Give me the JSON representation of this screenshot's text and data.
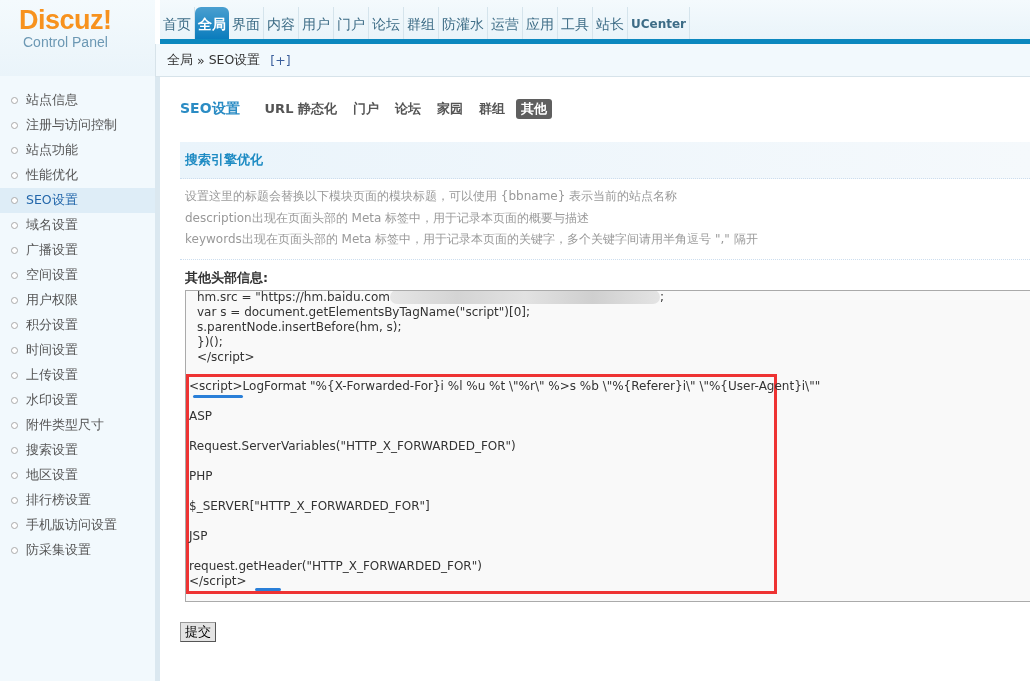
{
  "logo": {
    "brand": "Discuz",
    "mark": "!",
    "subtitle": "Control Panel"
  },
  "nav": [
    {
      "label": "首页",
      "selected": false
    },
    {
      "label": "全局",
      "selected": true
    },
    {
      "label": "界面",
      "selected": false
    },
    {
      "label": "内容",
      "selected": false
    },
    {
      "label": "用户",
      "selected": false
    },
    {
      "label": "门户",
      "selected": false
    },
    {
      "label": "论坛",
      "selected": false
    },
    {
      "label": "群组",
      "selected": false
    },
    {
      "label": "防灌水",
      "selected": false
    },
    {
      "label": "运营",
      "selected": false
    },
    {
      "label": "应用",
      "selected": false
    },
    {
      "label": "工具",
      "selected": false
    },
    {
      "label": "站长",
      "selected": false
    },
    {
      "label": "UCenter",
      "selected": false
    }
  ],
  "breadcrumb": {
    "section": "全局",
    "separator": "»",
    "page": "SEO设置",
    "add": "[+]"
  },
  "sidebar": {
    "items": [
      {
        "label": "站点信息",
        "selected": false
      },
      {
        "label": "注册与访问控制",
        "selected": false
      },
      {
        "label": "站点功能",
        "selected": false
      },
      {
        "label": "性能优化",
        "selected": false
      },
      {
        "label": "SEO设置",
        "selected": true
      },
      {
        "label": "域名设置",
        "selected": false
      },
      {
        "label": "广播设置",
        "selected": false
      },
      {
        "label": "空间设置",
        "selected": false
      },
      {
        "label": "用户权限",
        "selected": false
      },
      {
        "label": "积分设置",
        "selected": false
      },
      {
        "label": "时间设置",
        "selected": false
      },
      {
        "label": "上传设置",
        "selected": false
      },
      {
        "label": "水印设置",
        "selected": false
      },
      {
        "label": "附件类型尺寸",
        "selected": false
      },
      {
        "label": "搜索设置",
        "selected": false
      },
      {
        "label": "地区设置",
        "selected": false
      },
      {
        "label": "排行榜设置",
        "selected": false
      },
      {
        "label": "手机版访问设置",
        "selected": false
      },
      {
        "label": "防采集设置",
        "selected": false
      }
    ]
  },
  "page_title": "SEO设置",
  "tabs": [
    {
      "label": "URL 静态化",
      "selected": false
    },
    {
      "label": "门户",
      "selected": false
    },
    {
      "label": "论坛",
      "selected": false
    },
    {
      "label": "家园",
      "selected": false
    },
    {
      "label": "群组",
      "selected": false
    },
    {
      "label": "其他",
      "selected": true
    }
  ],
  "section_title": "搜索引擎优化",
  "tips": [
    "设置这里的标题会替换以下模块页面的模块标题，可以使用 {bbname} 表示当前的站点名称",
    "description出现在页面头部的 Meta 标签中，用于记录本页面的概要与描述",
    "keywords出现在页面头部的 Meta 标签中，用于记录本页面的关键字，多个关键字间请用半角逗号 \",\" 隔开"
  ],
  "field_label": "其他头部信息:",
  "code": {
    "lines": [
      {
        "text": "hm.src = \"https://hm.baidu.com",
        "redacted": true,
        "tail": ";"
      },
      {
        "text": "var s = document.getElementsByTagName(\"script\")[0];"
      },
      {
        "text": "s.parentNode.insertBefore(hm, s);"
      },
      {
        "text": "})();"
      },
      {
        "text": "</script>"
      }
    ],
    "highlighted": [
      {
        "parts": [
          {
            "text": "<script>",
            "underlined": true
          },
          {
            "text": "LogFormat \"%{X-Forwarded-For}i %l %u %t \\\"%r\\\" %>s %b \\\"%{Referer}i\\\" \\\"%{User-Agent}i\\\"\"",
            "underlined": false
          }
        ],
        "tight": false,
        "trailing_mark": false
      },
      {
        "parts": [
          {
            "text": "ASP",
            "underlined": false
          }
        ],
        "tight": false,
        "trailing_mark": false
      },
      {
        "parts": [
          {
            "text": "Request.ServerVariables(\"HTTP_X_FORWARDED_FOR\")",
            "underlined": false
          }
        ],
        "tight": false,
        "trailing_mark": false
      },
      {
        "parts": [
          {
            "text": "PHP",
            "underlined": false
          }
        ],
        "tight": false,
        "trailing_mark": false
      },
      {
        "parts": [
          {
            "text": "$_SERVER[\"HTTP_X_FORWARDED_FOR\"]",
            "underlined": false
          }
        ],
        "tight": false,
        "trailing_mark": false
      },
      {
        "parts": [
          {
            "text": "JSP",
            "underlined": false
          }
        ],
        "tight": false,
        "trailing_mark": false
      },
      {
        "parts": [
          {
            "text": "request.getHeader(\"HTTP_X_FORWARDED_FOR\")",
            "underlined": false
          }
        ],
        "tight": false,
        "trailing_mark": false
      },
      {
        "parts": [
          {
            "text": "</script>",
            "underlined": false
          }
        ],
        "tight": true,
        "trailing_mark": true
      }
    ]
  },
  "submit": "提交"
}
